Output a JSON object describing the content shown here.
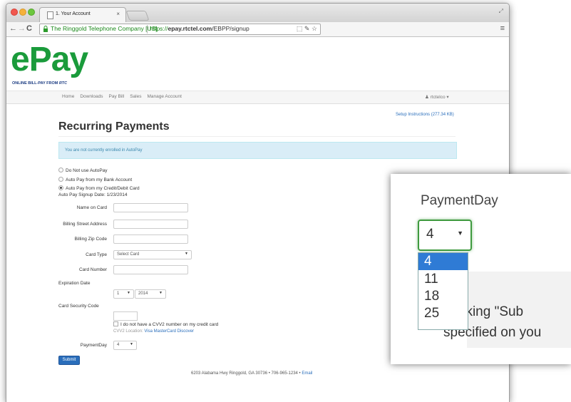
{
  "browser": {
    "tab_title": "1. Your Account",
    "tab_close": "×",
    "site_identity": "The Ringgold Telephone Company [US]",
    "url_scheme": "https://",
    "url_host": "epay.rtctel.com",
    "url_path": "/EBPP/signup",
    "resize_glyph": "⤢",
    "back_glyph": "←",
    "forward_glyph": "→",
    "reload_glyph": "C",
    "menu_glyph": "≡",
    "omni_icons": "⬚ ✎ ☆"
  },
  "brand": {
    "logo": "ePay",
    "tagline": "ONLINE BILL-PAY FROM",
    "tagline_mark": "RTC"
  },
  "nav": {
    "items": [
      "Home",
      "Downloads",
      "Pay Bill",
      "Sales",
      "Manage Account"
    ],
    "user": "rtctelco",
    "user_caret": "▾"
  },
  "setup_link": "Setup Instructions (277.34 KB)",
  "heading": "Recurring Payments",
  "alert": "You are not currently enrolled in AutoPay",
  "autopay_options": [
    {
      "label": "Do Not use AutoPay",
      "checked": false
    },
    {
      "label": "Auto Pay from my Bank Account",
      "checked": false
    },
    {
      "label": "Auto Pay from my Credit/Debit Card",
      "checked": true
    }
  ],
  "signup_date": "Auto Pay Signup Date: 1/23/2014",
  "form": {
    "name_on_card": "Name on Card",
    "billing_street": "Billing Street Address",
    "billing_zip": "Billing Zip Code",
    "card_type": "Card Type",
    "card_type_value": "Select Card",
    "card_number": "Card Number",
    "expiration_date": "Expiration Date",
    "exp_month": "1",
    "exp_year": "2014",
    "security_code": "Card Security Code",
    "no_cvv": "I do not have a CVV2 number on my credit card",
    "cvv_location": "CVV2 Location:",
    "cvv_links": "Visa MasterCard Discover",
    "payment_day": "PaymentDay",
    "payment_day_value": "4",
    "submit": "Submit"
  },
  "footer": {
    "address": "6203 Alabama Hwy Ringgold, GA 30736 • 706-965-1234 •",
    "email": "Email"
  },
  "zoom": {
    "title": "PaymentDay",
    "selected": "4",
    "options": [
      "4",
      "11",
      "18",
      "25"
    ],
    "highlighted_index": 0,
    "text_line1": "clicking \"Sub",
    "text_line2": "specified on you"
  }
}
